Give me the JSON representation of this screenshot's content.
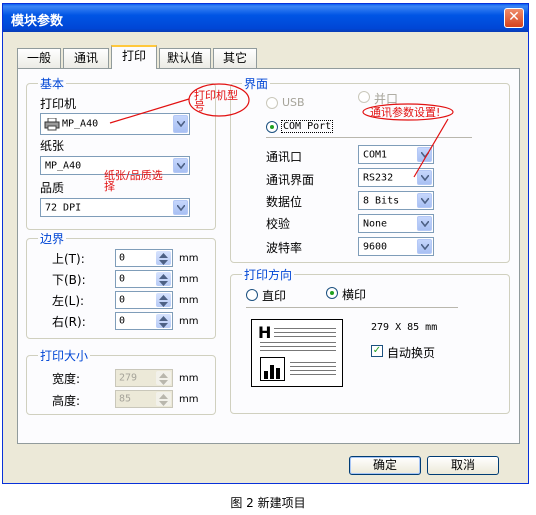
{
  "window": {
    "title": "模块参数",
    "close": "✕"
  },
  "tabs": [
    "一般",
    "通讯",
    "打印",
    "默认值",
    "其它"
  ],
  "basic": {
    "legend": "基本",
    "printer_label": "打印机",
    "printer_value": "MP_A40",
    "paper_label": "纸张",
    "paper_value": "MP_A40",
    "quality_label": "品质",
    "quality_value": "72 DPI"
  },
  "margins": {
    "legend": "边界",
    "rows": [
      {
        "label": "上(T):",
        "value": "0",
        "unit": "mm"
      },
      {
        "label": "下(B):",
        "value": "0",
        "unit": "mm"
      },
      {
        "label": "左(L):",
        "value": "0",
        "unit": "mm"
      },
      {
        "label": "右(R):",
        "value": "0",
        "unit": "mm"
      }
    ]
  },
  "print_size": {
    "legend": "打印大小",
    "width_label": "宽度:",
    "width_value": "279",
    "width_unit": "mm",
    "height_label": "高度:",
    "height_value": "85",
    "height_unit": "mm"
  },
  "interface": {
    "legend": "界面",
    "usb": "USB",
    "parallel": "并口",
    "com": "COM Port",
    "port_label": "通讯口",
    "port_value": "COM1",
    "iface_label": "通讯界面",
    "iface_value": "RS232",
    "bits_label": "数据位",
    "bits_value": "8 Bits",
    "parity_label": "校验",
    "parity_value": "None",
    "baud_label": "波特率",
    "baud_value": "9600"
  },
  "orientation": {
    "legend": "打印方向",
    "portrait": "直印",
    "landscape": "横印",
    "size_text": "279 X 85 mm",
    "auto_page": "自动换页",
    "preview_letter": "H"
  },
  "buttons": {
    "ok": "确定",
    "cancel": "取消"
  },
  "annotations": {
    "printer_model": "打印机型号",
    "paper_quality": "纸张/品质选择",
    "comm_settings": "通讯参数设置!"
  },
  "caption": "图 2 新建项目",
  "colors": {
    "accent": "#0046d5",
    "annotation": "#e21111",
    "titlebar": "#0055e5"
  }
}
